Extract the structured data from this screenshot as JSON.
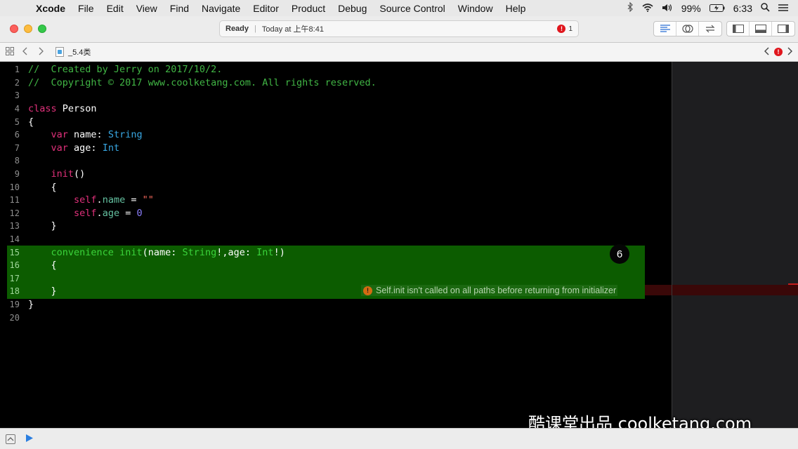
{
  "menubar": {
    "apple": "",
    "items": [
      "Xcode",
      "File",
      "Edit",
      "View",
      "Find",
      "Navigate",
      "Editor",
      "Product",
      "Debug",
      "Source Control",
      "Window",
      "Help"
    ],
    "battery": "99%",
    "time": "6:33"
  },
  "toolbar": {
    "status": "Ready",
    "separator": "|",
    "timestamp": "Today at 上午8:41",
    "error_count": "1",
    "error_symbol": "!"
  },
  "jumpbar": {
    "file_name": "_5.4类",
    "error_symbol": "!"
  },
  "editor": {
    "lines": [
      {
        "n": "1",
        "segs": [
          {
            "c": "cm",
            "t": "//  Created by Jerry on 2017/10/2."
          }
        ]
      },
      {
        "n": "2",
        "segs": [
          {
            "c": "cm",
            "t": "//  Copyright © 2017 www.coolketang.com. All rights reserved."
          }
        ]
      },
      {
        "n": "3",
        "segs": []
      },
      {
        "n": "4",
        "segs": [
          {
            "c": "kw",
            "t": "class"
          },
          {
            "c": "",
            "t": " Person"
          }
        ]
      },
      {
        "n": "5",
        "segs": [
          {
            "c": "",
            "t": "{"
          }
        ]
      },
      {
        "n": "6",
        "segs": [
          {
            "c": "",
            "t": "    "
          },
          {
            "c": "kw",
            "t": "var"
          },
          {
            "c": "",
            "t": " name: "
          },
          {
            "c": "ty",
            "t": "String"
          }
        ]
      },
      {
        "n": "7",
        "segs": [
          {
            "c": "",
            "t": "    "
          },
          {
            "c": "kw",
            "t": "var"
          },
          {
            "c": "",
            "t": " age: "
          },
          {
            "c": "ty",
            "t": "Int"
          }
        ]
      },
      {
        "n": "8",
        "segs": []
      },
      {
        "n": "9",
        "segs": [
          {
            "c": "",
            "t": "    "
          },
          {
            "c": "kw",
            "t": "init"
          },
          {
            "c": "",
            "t": "()"
          }
        ]
      },
      {
        "n": "10",
        "segs": [
          {
            "c": "",
            "t": "    {"
          }
        ]
      },
      {
        "n": "11",
        "segs": [
          {
            "c": "",
            "t": "        "
          },
          {
            "c": "kw",
            "t": "self"
          },
          {
            "c": "",
            "t": "."
          },
          {
            "c": "prop",
            "t": "name"
          },
          {
            "c": "",
            "t": " = "
          },
          {
            "c": "str",
            "t": "\"\""
          }
        ]
      },
      {
        "n": "12",
        "segs": [
          {
            "c": "",
            "t": "        "
          },
          {
            "c": "kw",
            "t": "self"
          },
          {
            "c": "",
            "t": "."
          },
          {
            "c": "prop",
            "t": "age"
          },
          {
            "c": "",
            "t": " = "
          },
          {
            "c": "num",
            "t": "0"
          }
        ]
      },
      {
        "n": "13",
        "segs": [
          {
            "c": "",
            "t": "    }"
          }
        ]
      },
      {
        "n": "14",
        "segs": []
      },
      {
        "n": "15",
        "hl": true,
        "segs": [
          {
            "c": "",
            "t": "    "
          },
          {
            "c": "kw",
            "t": "convenience"
          },
          {
            "c": "",
            "t": " "
          },
          {
            "c": "kw",
            "t": "init"
          },
          {
            "c": "",
            "t": "(name: "
          },
          {
            "c": "ty",
            "t": "String"
          },
          {
            "c": "",
            "t": "!,age: "
          },
          {
            "c": "ty",
            "t": "Int"
          },
          {
            "c": "",
            "t": "!)"
          }
        ]
      },
      {
        "n": "16",
        "hl": true,
        "segs": [
          {
            "c": "",
            "t": "    {"
          }
        ]
      },
      {
        "n": "17",
        "hl": true,
        "segs": []
      },
      {
        "n": "18",
        "hl": true,
        "segs": [
          {
            "c": "",
            "t": "    }"
          }
        ]
      },
      {
        "n": "19",
        "segs": [
          {
            "c": "",
            "t": "}"
          }
        ]
      },
      {
        "n": "20",
        "segs": []
      }
    ],
    "error_message": "Self.init isn't called on all paths before returning from initializer",
    "warning_symbol": "!",
    "step_number": "6"
  },
  "watermark": "酷课堂出品 coolketang.com",
  "colors": {
    "comment": "#41b645",
    "keyword": "#e1317b",
    "type": "#38a7e3",
    "number": "#8a7dfa",
    "string": "#fc6a5d",
    "highlight": "#0c5c00",
    "error": "#e0161d"
  }
}
